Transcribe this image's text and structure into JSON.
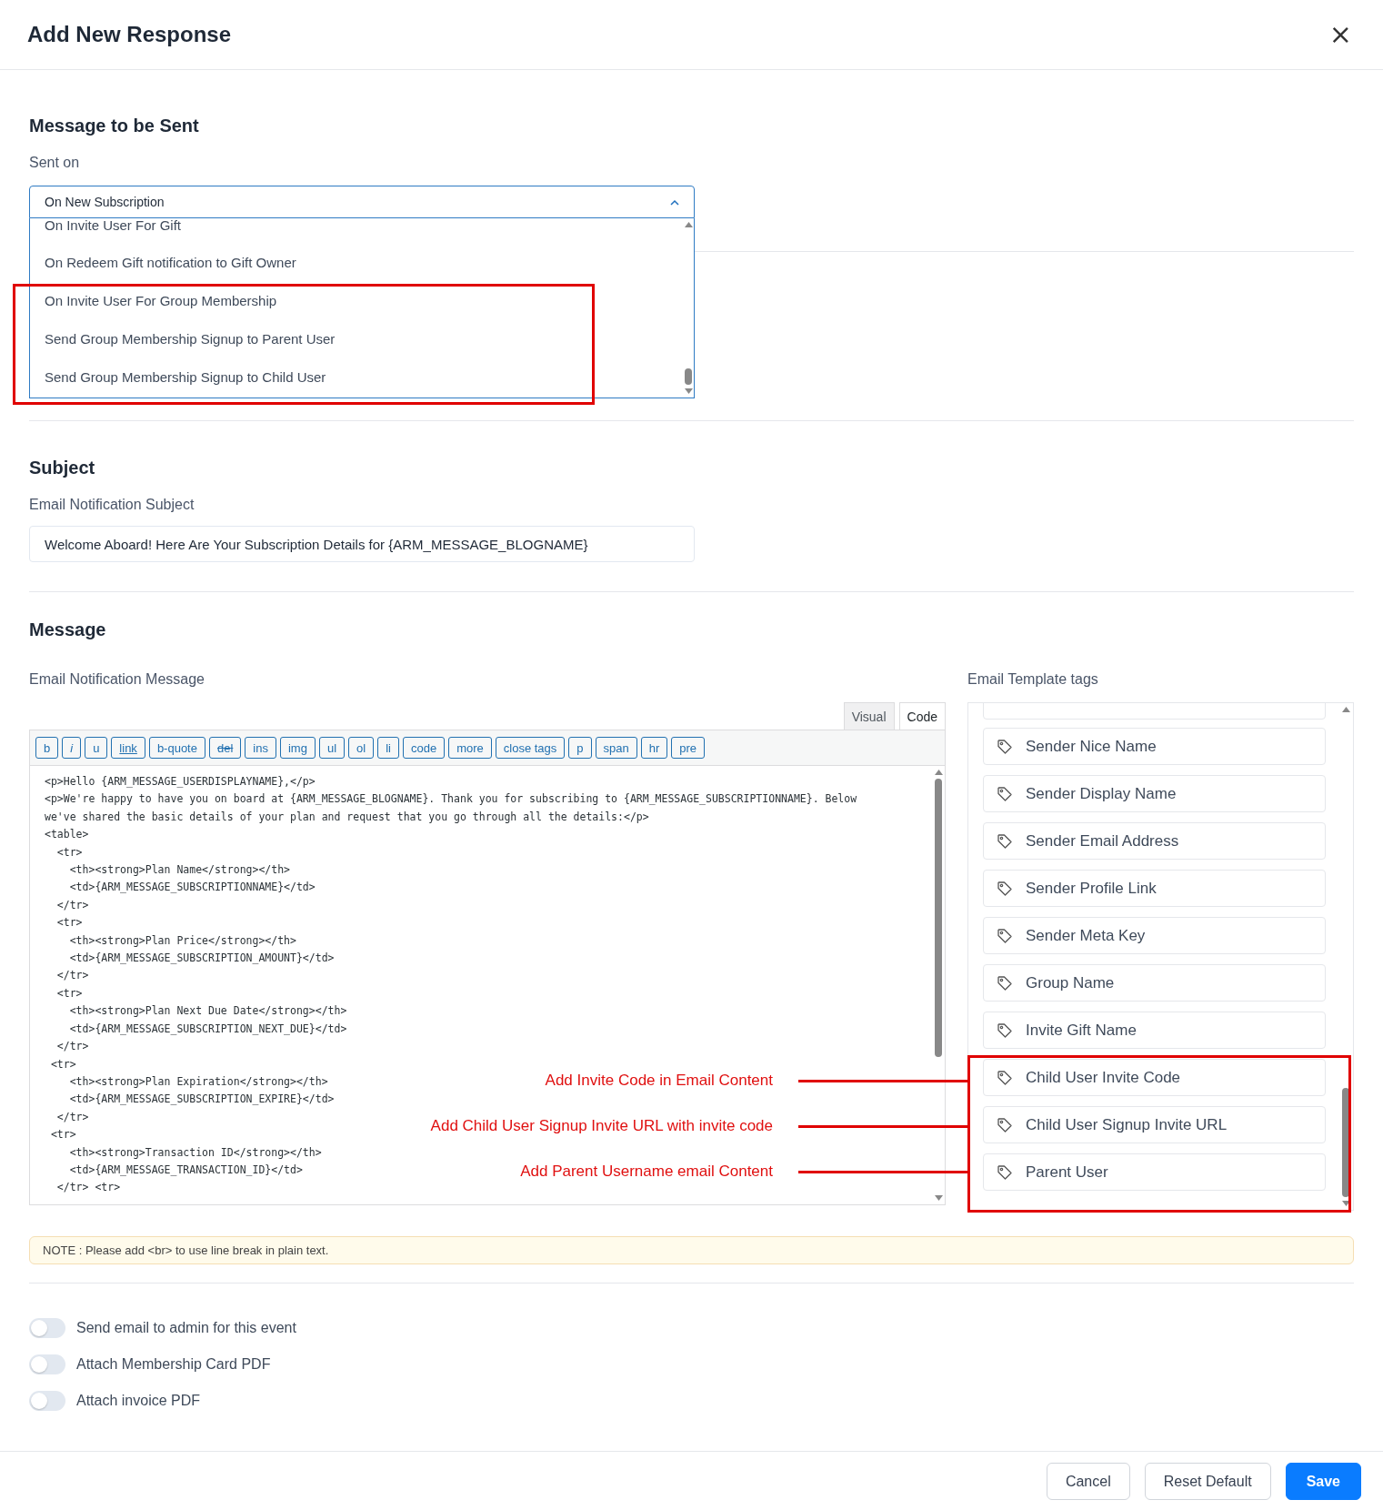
{
  "dialog": {
    "title": "Add New Response",
    "close": "×"
  },
  "message_section": {
    "heading": "Message to be Sent",
    "label": "Sent on",
    "value": "On New Subscription",
    "options": [
      "On Invite User For Gift",
      "On Redeem Gift notification to Gift Owner",
      "On Invite User For Group Membership",
      "Send Group Membership Signup to Parent User",
      "Send Group Membership Signup to Child User"
    ]
  },
  "subject_section": {
    "heading": "Subject",
    "label": "Email Notification Subject",
    "value": "Welcome Aboard! Here Are Your Subscription Details for {ARM_MESSAGE_BLOGNAME}"
  },
  "message": {
    "heading": "Message",
    "label": "Email Notification Message",
    "tabs": [
      {
        "label": "Visual",
        "selected": false
      },
      {
        "label": "Code",
        "selected": true
      }
    ],
    "toolbar": [
      {
        "label": "b",
        "kind": "plain"
      },
      {
        "label": "i",
        "kind": "italic"
      },
      {
        "label": "u",
        "kind": "plain"
      },
      {
        "label": "link",
        "kind": "underline"
      },
      {
        "label": "b-quote",
        "kind": "plain"
      },
      {
        "label": "del",
        "kind": "strike"
      },
      {
        "label": "ins",
        "kind": "plain"
      },
      {
        "label": "img",
        "kind": "plain"
      },
      {
        "label": "ul",
        "kind": "plain"
      },
      {
        "label": "ol",
        "kind": "plain"
      },
      {
        "label": "li",
        "kind": "plain"
      },
      {
        "label": "code",
        "kind": "plain"
      },
      {
        "label": "more",
        "kind": "plain"
      },
      {
        "label": "close tags",
        "kind": "plain"
      },
      {
        "label": "p",
        "kind": "plain"
      },
      {
        "label": "span",
        "kind": "plain"
      },
      {
        "label": "hr",
        "kind": "plain"
      },
      {
        "label": "pre",
        "kind": "plain"
      }
    ],
    "code_lines": [
      "<p>Hello {ARM_MESSAGE_USERDISPLAYNAME},</p>",
      "<p>We're happy to have you on board at {ARM_MESSAGE_BLOGNAME}. Thank you for subscribing to {ARM_MESSAGE_SUBSCRIPTIONNAME}. Below",
      "we've shared the basic details of your plan and request that you go through all the details:</p>",
      "<table>",
      "  <tr>",
      "    <th><strong>Plan Name</strong></th>",
      "    <td>{ARM_MESSAGE_SUBSCRIPTIONNAME}</td>",
      "  </tr>",
      "  <tr>",
      "    <th><strong>Plan Price</strong></th>",
      "    <td>{ARM_MESSAGE_SUBSCRIPTION_AMOUNT}</td>",
      "  </tr>",
      "  <tr>",
      "    <th><strong>Plan Next Due Date</strong></th>",
      "    <td>{ARM_MESSAGE_SUBSCRIPTION_NEXT_DUE}</td>",
      "  </tr>",
      " <tr>",
      "    <th><strong>Plan Expiration</strong></th>",
      "    <td>{ARM_MESSAGE_SUBSCRIPTION_EXPIRE}</td>",
      "  </tr>",
      " <tr>",
      "    <th><strong>Transaction ID</strong></th>",
      "    <td>{ARM_MESSAGE_TRANSACTION_ID}</td>",
      "  </tr> <tr>"
    ],
    "tags_label": "Email Template tags",
    "tags": [
      "Sender Nice Name",
      "Sender Display Name",
      "Sender Email Address",
      "Sender Profile Link",
      "Sender Meta Key",
      "Group Name",
      "Invite Gift Name",
      "Child User Invite Code",
      "Child User Signup Invite URL",
      "Parent User"
    ],
    "note": "NOTE : Please add <br> to use line break in plain text."
  },
  "annotations": [
    "Add Invite Code in Email Content",
    "Add Child User Signup Invite URL with invite code",
    "Add Parent Username email Content"
  ],
  "toggles": [
    {
      "label": "Send email to admin for this event",
      "on": false
    },
    {
      "label": "Attach Membership Card PDF",
      "on": false
    },
    {
      "label": "Attach invoice PDF",
      "on": false
    }
  ],
  "buttons": [
    "Cancel",
    "Reset Default",
    "Save"
  ]
}
